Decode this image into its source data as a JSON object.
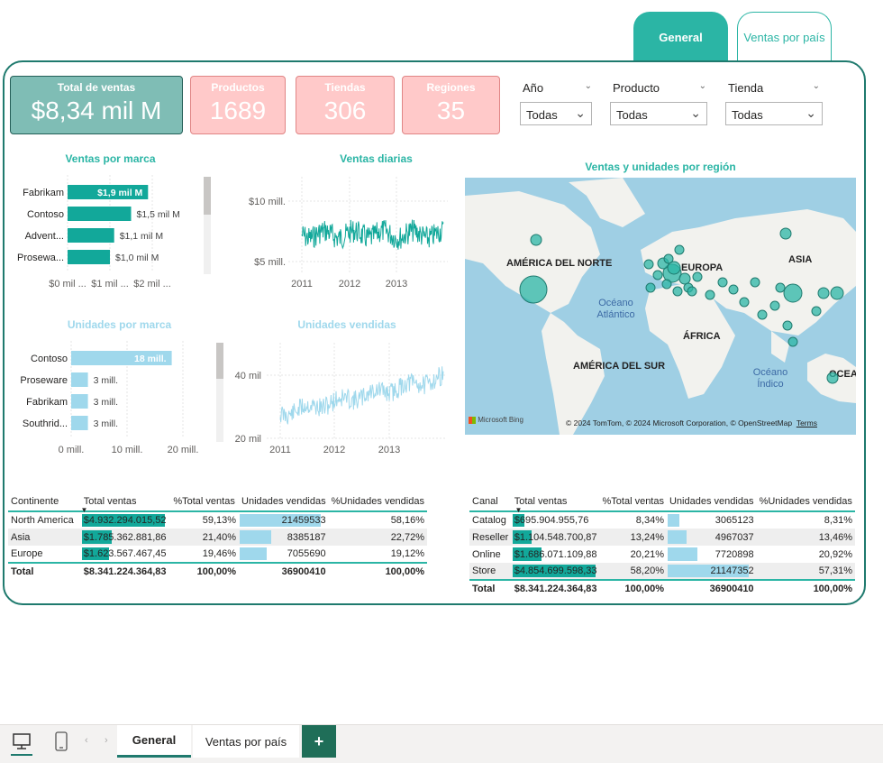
{
  "tabs": {
    "general": "General",
    "por_pais": "Ventas por país"
  },
  "kpis": {
    "total": {
      "label": "Total de ventas",
      "value": "$8,34 mil M"
    },
    "productos": {
      "label": "Productos",
      "value": "1689"
    },
    "tiendas": {
      "label": "Tiendas",
      "value": "306"
    },
    "regiones": {
      "label": "Regiones",
      "value": "35"
    }
  },
  "slicers": [
    {
      "title": "Año",
      "value": "Todas"
    },
    {
      "title": "Producto",
      "value": "Todas"
    },
    {
      "title": "Tienda",
      "value": "Todas"
    }
  ],
  "ventas_marca": {
    "title": "Ventas por marca",
    "bars": [
      {
        "label": "Fabrikam",
        "value_label": "$1,9 mil M",
        "value": 1.9
      },
      {
        "label": "Contoso",
        "value_label": "$1,5 mil M",
        "value": 1.5
      },
      {
        "label": "Advent...",
        "value_label": "$1,1 mil M",
        "value": 1.1
      },
      {
        "label": "Prosewa...",
        "value_label": "$1,0 mil M",
        "value": 1.0
      }
    ],
    "xticks": [
      "$0 mil ...",
      "$1 mil ...",
      "$2 mil ..."
    ]
  },
  "ventas_diarias": {
    "title": "Ventas diarias",
    "yticks": [
      "$10 mill.",
      "$5 mill."
    ],
    "xticks": [
      "2011",
      "2012",
      "2013"
    ]
  },
  "unidades_marca": {
    "title": "Unidades por marca",
    "bars": [
      {
        "label": "Contoso",
        "value_label": "18 mill.",
        "value": 18
      },
      {
        "label": "Proseware",
        "value_label": "3 mill.",
        "value": 3
      },
      {
        "label": "Fabrikam",
        "value_label": "3 mill.",
        "value": 3
      },
      {
        "label": "Southrid...",
        "value_label": "3 mill.",
        "value": 3
      }
    ],
    "xticks": [
      "0 mill.",
      "10 mill.",
      "20 mill."
    ]
  },
  "unidades_vendidas": {
    "title": "Unidades vendidas",
    "yticks": [
      "40 mil",
      "20 mil"
    ],
    "xticks": [
      "2011",
      "2012",
      "2013"
    ]
  },
  "mapa": {
    "title": "Ventas y unidades por región",
    "labels": [
      "AMÉRICA DEL NORTE",
      "EUROPA",
      "ASIA",
      "ÁFRICA",
      "AMÉRICA DEL SUR",
      "OCEA"
    ],
    "oceans": [
      "Océano Atlántico",
      "Océano Índico"
    ],
    "bing": "Microsoft Bing",
    "copyright": "© 2024 TomTom, © 2024 Microsoft Corporation, © OpenStreetMap",
    "terms": "Terms"
  },
  "tabla_continente": {
    "headers": [
      "Continente",
      "Total ventas",
      "%Total ventas",
      "Unidades vendidas",
      "%Unidades vendidas"
    ],
    "rows": [
      {
        "name": "North America",
        "ventas": "$4.932.294.015,52",
        "pct_v": "59,13%",
        "unidades": "21459533",
        "pct_u": "58,16%",
        "frac_v": 1.0,
        "frac_u": 1.0
      },
      {
        "name": "Asia",
        "ventas": "$1.785.362.881,86",
        "pct_v": "21,40%",
        "unidades": "8385187",
        "pct_u": "22,72%",
        "frac_v": 0.36,
        "frac_u": 0.39
      },
      {
        "name": "Europe",
        "ventas": "$1.623.567.467,45",
        "pct_v": "19,46%",
        "unidades": "7055690",
        "pct_u": "19,12%",
        "frac_v": 0.33,
        "frac_u": 0.33
      }
    ],
    "total": {
      "name": "Total",
      "ventas": "$8.341.224.364,83",
      "pct_v": "100,00%",
      "unidades": "36900410",
      "pct_u": "100,00%"
    }
  },
  "tabla_canal": {
    "headers": [
      "Canal",
      "Total ventas",
      "%Total ventas",
      "Unidades vendidas",
      "%Unidades vendidas"
    ],
    "rows": [
      {
        "name": "Catalog",
        "ventas": "$695.904.955,76",
        "pct_v": "8,34%",
        "unidades": "3065123",
        "pct_u": "8,31%",
        "frac_v": 0.14,
        "frac_u": 0.14
      },
      {
        "name": "Reseller",
        "ventas": "$1.104.548.700,87",
        "pct_v": "13,24%",
        "unidades": "4967037",
        "pct_u": "13,46%",
        "frac_v": 0.23,
        "frac_u": 0.23
      },
      {
        "name": "Online",
        "ventas": "$1.686.071.109,88",
        "pct_v": "20,21%",
        "unidades": "7720898",
        "pct_u": "20,92%",
        "frac_v": 0.35,
        "frac_u": 0.37
      },
      {
        "name": "Store",
        "ventas": "$4.854.699.598,33",
        "pct_v": "58,20%",
        "unidades": "21147352",
        "pct_u": "57,31%",
        "frac_v": 1.0,
        "frac_u": 1.0
      }
    ],
    "total": {
      "name": "Total",
      "ventas": "$8.341.224.364,83",
      "pct_v": "100,00%",
      "unidades": "36900410",
      "pct_u": "100,00%"
    }
  },
  "bottom_tabs": {
    "general": "General",
    "por_pais": "Ventas por país",
    "add": "+"
  },
  "colors": {
    "teal": "#2bb5a5",
    "dark_teal": "#1f7a6e",
    "light_blue": "#9fd8ec",
    "pink": "#ffc9c9"
  }
}
